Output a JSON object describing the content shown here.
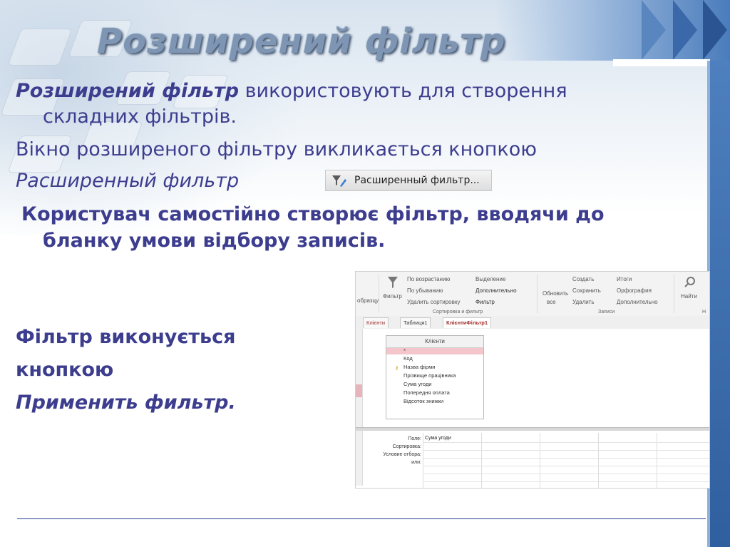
{
  "slide": {
    "title": "Розширений фільтр",
    "para1_bold": "Розширений фільтр",
    "para1_rest": " використовують для створення",
    "para1_line2": "складних фільтрів.",
    "para2": "Вікно розширеного фільтру викликається кнопкою",
    "para2_italic": "Расширенный фильтр",
    "para3_line1": "Користувач самостійно створює фільтр, вводячи до",
    "para3_line2": "бланку умови відбору записів.",
    "para4_line1": "Фільтр виконується",
    "para4_line2": "кнопкою",
    "para4_line3": "Применить фильтр."
  },
  "button_image": {
    "icon": "funnel-pencil-icon",
    "label": "Расширенный фильтр..."
  },
  "access_screenshot": {
    "ribbon": {
      "cut_label": "образцу",
      "filter_label": "Фильтр",
      "sort_asc": "По возрастанию",
      "sort_desc": "По убыванию",
      "remove_sort": "Удалить сортировку",
      "selection": "Выделение",
      "advanced": "Дополнительно",
      "toggle_filter": "Фильтр",
      "refresh_all": "Обновить",
      "refresh_all2": "все",
      "create": "Создать",
      "save": "Сохранить",
      "delete": "Удалить",
      "totals": "Итоги",
      "spelling": "Орфография",
      "more": "Дополнительно",
      "find": "Найти",
      "group_sort_filter": "Сортировка и фильтр",
      "group_records": "Записи",
      "group_find_initial": "Н"
    },
    "tabs": [
      "Клієнти",
      "Таблиця1",
      "КлієнтиФільтр1"
    ],
    "table": {
      "name": "Клієнти",
      "star": "*",
      "fields": [
        "Код",
        "Назва фірми",
        "Прізвище працівника",
        "Сума угоди",
        "Попередня оплата",
        "Відсоток знижки"
      ]
    },
    "grid": {
      "row_labels": [
        "Поле:",
        "Сортировка:",
        "Условие отбора:",
        "или:"
      ],
      "field_value": "Сума угоди"
    }
  }
}
